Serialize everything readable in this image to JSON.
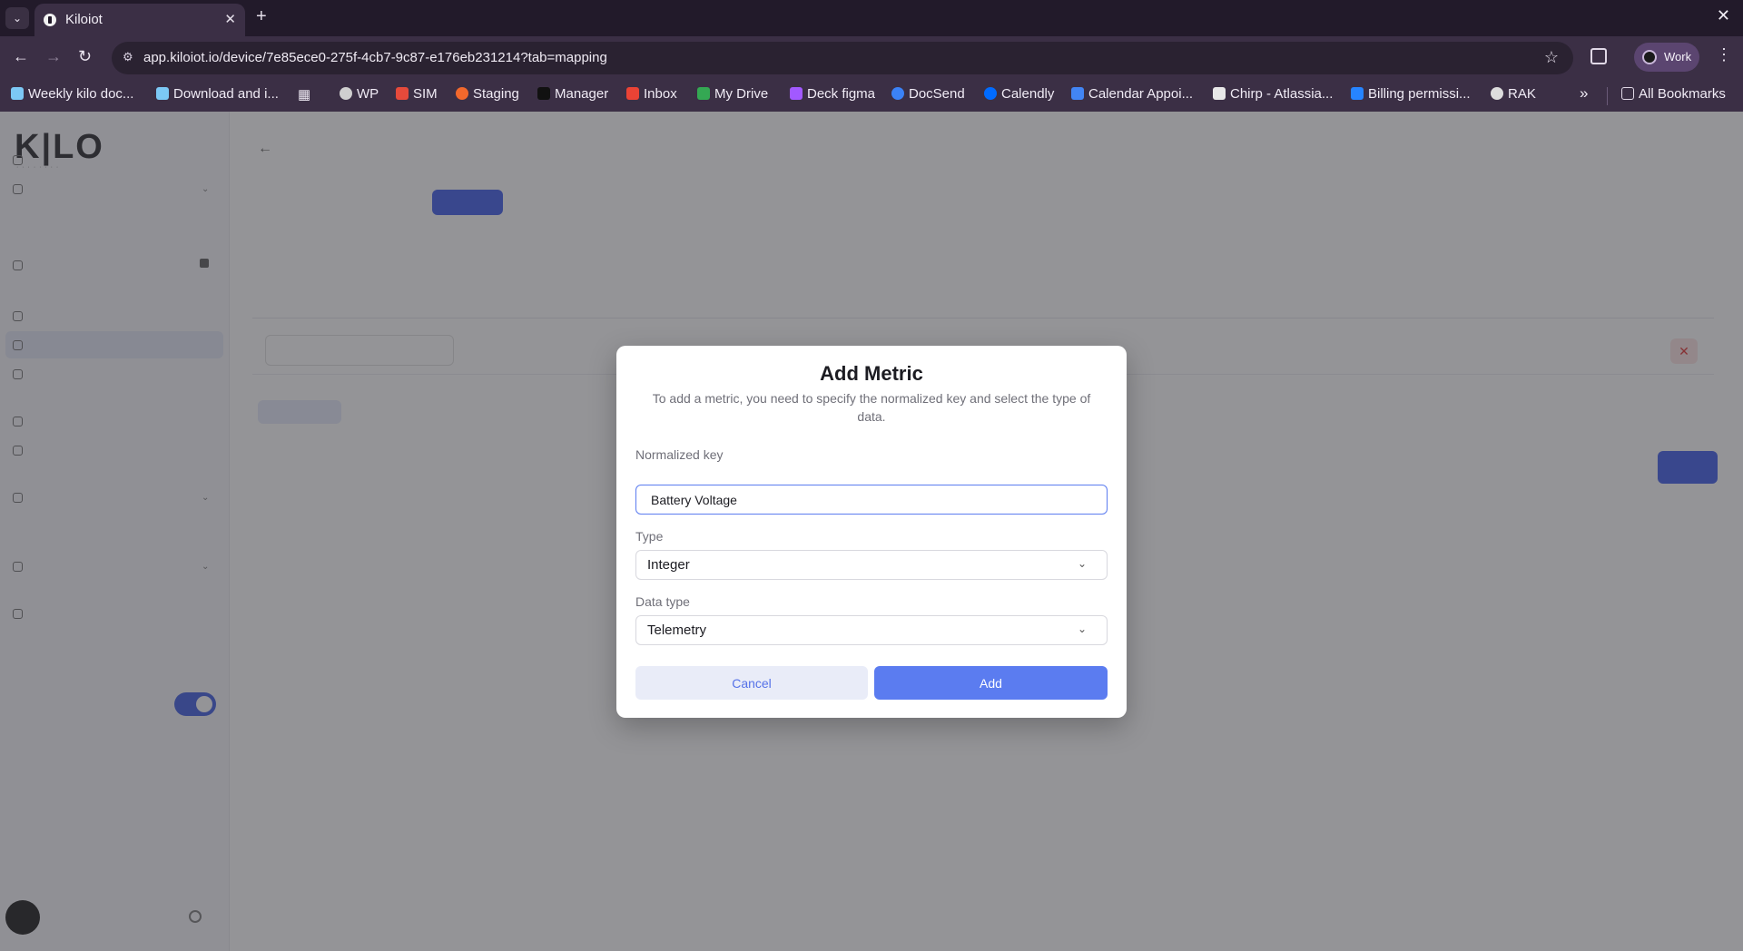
{
  "browser": {
    "tab_title": "Kiloiot",
    "url": "app.kiloiot.io/device/7e85ece0-275f-4cb7-9c87-e176eb231214?tab=mapping",
    "profile_label": "Work",
    "bookmarks": [
      "Weekly kilo doc...",
      "Download and i...",
      "WP",
      "SIM",
      "Staging",
      "Manager",
      "Inbox",
      "My Drive",
      "Deck figma",
      "DocSend",
      "Calendly",
      "Calendar Appoi...",
      "Chirp - Atlassia...",
      "Billing permissi...",
      "RAK"
    ],
    "all_bookmarks": "All Bookmarks"
  },
  "modal": {
    "title": "Add Metric",
    "description": "To add a metric, you need to specify the normalized key and select the type of data.",
    "normalized_key_label": "Normalized key",
    "normalized_key_value": "Battery Voltage",
    "type_label": "Type",
    "type_value": "Integer",
    "data_type_label": "Data type",
    "data_type_value": "Telemetry",
    "cancel_label": "Cancel",
    "add_label": "Add"
  },
  "colors": {
    "accent": "#5b7cf0",
    "browser_bg": "#3b2f45"
  }
}
